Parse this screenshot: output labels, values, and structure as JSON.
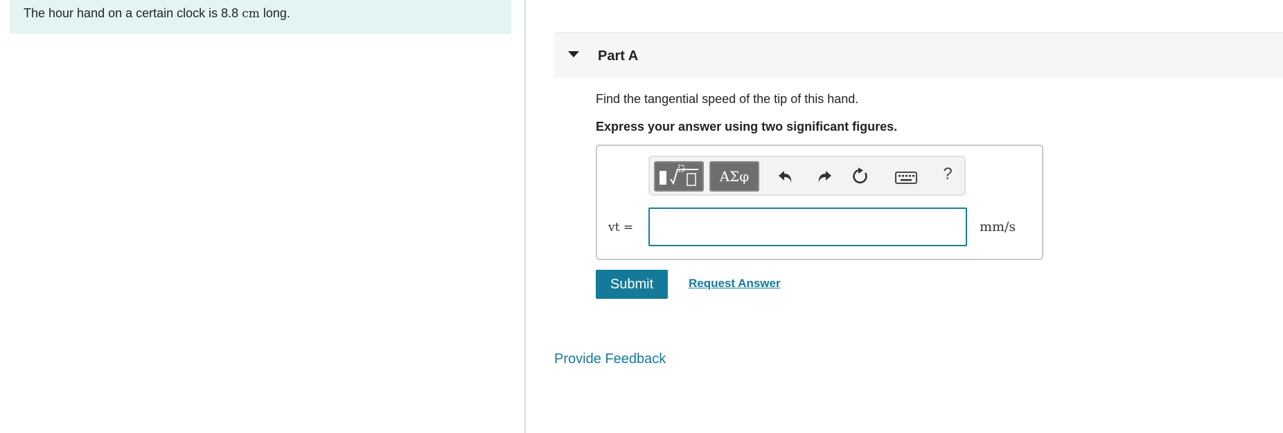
{
  "problem": {
    "intro_before": "The hour hand on a certain clock is 8.8 ",
    "intro_unit": "cm",
    "intro_after": " long."
  },
  "part": {
    "title": "Part A",
    "question": "Find the tangential speed of the tip of this hand.",
    "instruction": "Express your answer using two significant figures."
  },
  "toolbar": {
    "greek_label": "ΑΣφ",
    "help_label": "?",
    "icons": [
      "templates-icon",
      "greek-symbols-icon",
      "undo-icon",
      "redo-icon",
      "reset-icon",
      "keyboard-icon",
      "help-icon"
    ]
  },
  "answer": {
    "variable_label": "vt =",
    "value": "",
    "unit": "mm/s"
  },
  "actions": {
    "submit_label": "Submit",
    "request_answer_label": "Request Answer"
  },
  "feedback": {
    "label": "Provide Feedback"
  },
  "colors": {
    "accent": "#157a9a",
    "intro_background": "#e4f4f4",
    "input_border": "#1e7a99"
  }
}
